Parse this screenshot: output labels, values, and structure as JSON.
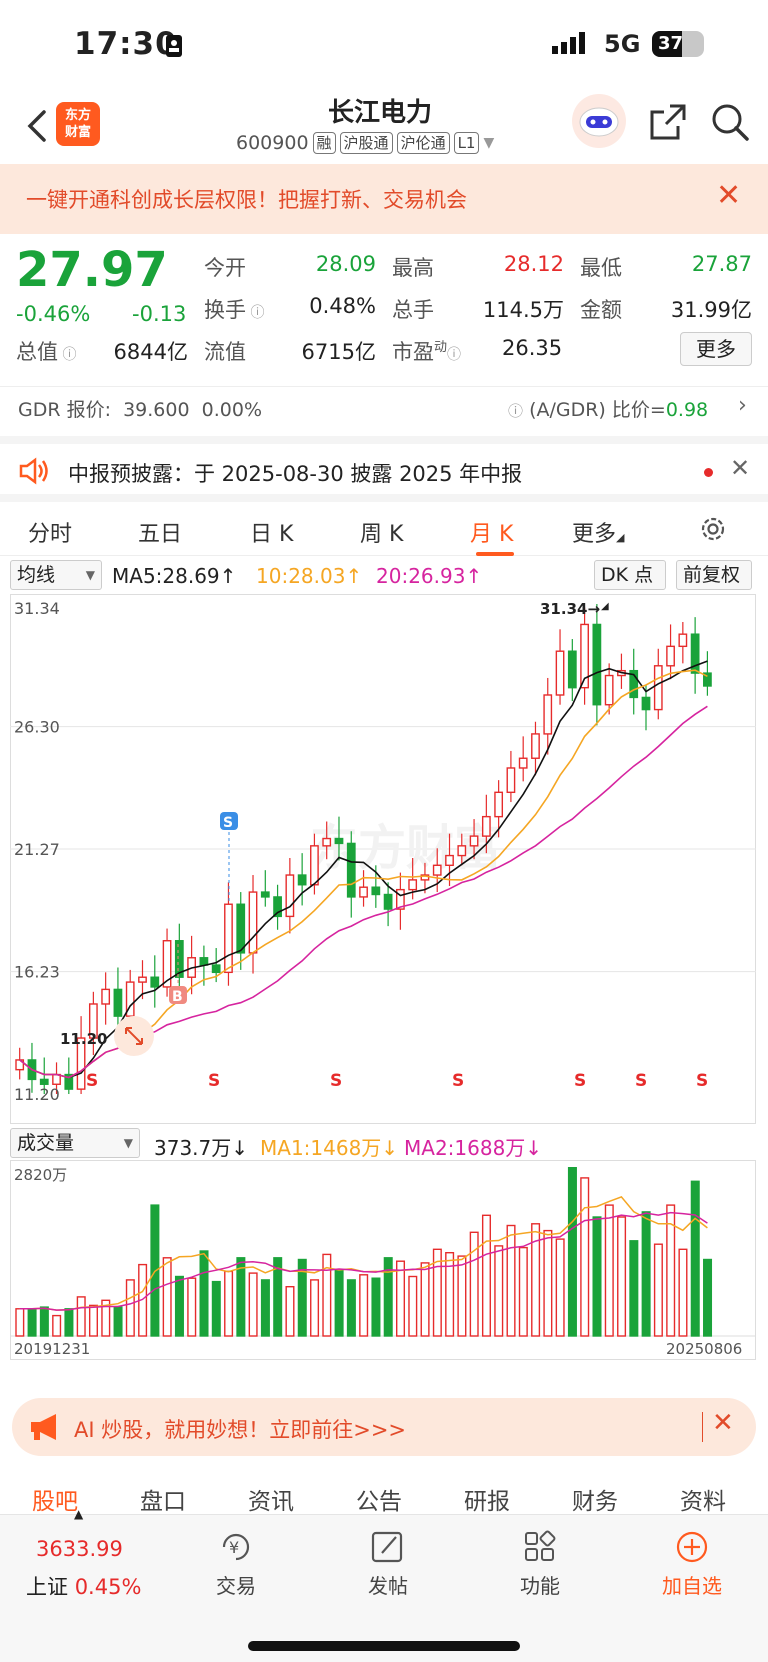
{
  "status_bar": {
    "time": "17:30",
    "network": "5G",
    "battery": "37"
  },
  "header": {
    "title": "长江电力",
    "code": "600900",
    "tags": [
      "融",
      "沪股通",
      "沪伦通",
      "L1"
    ],
    "logo_text": "东方财富"
  },
  "banner": {
    "text": "一键开通科创成长层权限！把握打新、交易机会"
  },
  "quote": {
    "price": "27.97",
    "change_pct": "-0.46%",
    "change": "-0.13",
    "open_label": "今开",
    "open": "28.09",
    "high_label": "最高",
    "high": "28.12",
    "low_label": "最低",
    "low": "27.87",
    "turnover_label": "换手",
    "turnover": "0.48%",
    "volume_label": "总手",
    "volume": "114.5万",
    "amount_label": "金额",
    "amount": "31.99亿",
    "total_mv_label": "总值",
    "total_mv": "6844亿",
    "float_mv_label": "流值",
    "float_mv": "6715亿",
    "pe_label": "市盈",
    "pe_sup": "动",
    "pe": "26.35",
    "more_label": "更多"
  },
  "gdr": {
    "label": "GDR 报价:",
    "price": "39.600",
    "pct": "0.00%",
    "ratio_label": "(A/GDR) 比价=",
    "ratio": "0.98"
  },
  "notice": {
    "text": "中报预披露：于 2025-08-30 披露 2025 年中报"
  },
  "tabs": [
    "分时",
    "五日",
    "日 K",
    "周 K",
    "月 K",
    "更多"
  ],
  "ma": {
    "selector": "均线",
    "ma5": "MA5:28.69↑",
    "ma10": "10:28.03↑",
    "ma20": "20:26.93↑",
    "dk": "DK 点",
    "adjust": "前复权"
  },
  "chart_data": {
    "type": "candlestick",
    "y_ticks": [
      "31.34",
      "26.30",
      "21.27",
      "16.23",
      "11.20"
    ],
    "ylim": [
      11.2,
      31.34
    ],
    "max_label": "31.34",
    "min_label": "11.20",
    "watermark": "东方财富",
    "signals": [
      "S",
      "S",
      "S",
      "S",
      "S",
      "S",
      "S"
    ],
    "markers": [
      "S",
      "B"
    ],
    "colors": {
      "up": "#e62b2b",
      "down": "#1aa33a",
      "ma5": "#111111",
      "ma10": "#f5a623",
      "ma20": "#d6249f"
    }
  },
  "volume": {
    "selector": "成交量",
    "value": "373.7万↓",
    "ma1": "MA1:1468万↓",
    "ma2": "MA2:1688万↓",
    "max_label": "2820万",
    "start_date": "20191231",
    "end_date": "20250806"
  },
  "ai_bar": {
    "text": "AI 炒股，就用妙想！立即前往>>>"
  },
  "bottom_tabs": [
    "股吧",
    "盘口",
    "资讯",
    "公告",
    "研报",
    "财务",
    "资料"
  ],
  "toolbar": {
    "index_value": "3633.99",
    "index_name": "上证",
    "index_pct": "0.45%",
    "trade": "交易",
    "post": "发帖",
    "func": "功能",
    "add": "加自选"
  }
}
